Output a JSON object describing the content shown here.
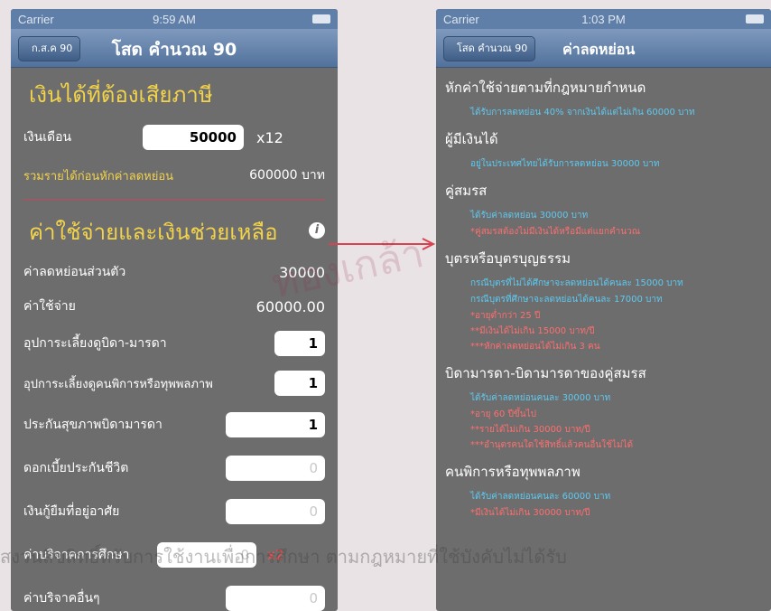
{
  "left": {
    "status": {
      "carrier": "Carrier",
      "time": "9:59 AM"
    },
    "nav": {
      "back": "ก.ส.ค 90",
      "title": "โสด คำนวณ 90"
    },
    "income_header": "เงินได้ที่ต้องเสียภาษี",
    "salary_label": "เงินเดือน",
    "salary_value": "50000",
    "salary_multiplier": "x12",
    "total_label": "รวมรายได้ก่อนหักค่าลดหย่อน",
    "total_value": "600000 บาท",
    "expense_header": "ค่าใช้จ่ายและเงินช่วยเหลือ",
    "rows": [
      {
        "label": "ค่าลดหย่อนส่วนตัว",
        "value": "30000"
      },
      {
        "label": "ค่าใช้จ่าย",
        "value": "60000.00"
      }
    ],
    "fields": [
      {
        "label": "อุปการะเลี้ยงดูบิดา-มารดา",
        "value": "1"
      },
      {
        "label": "อุปการะเลี้ยงดูคนพิการหรือทุพพลภาพ",
        "value": "1"
      },
      {
        "label": "ประกันสุขภาพบิดามารดา",
        "value": "1"
      },
      {
        "label": "ดอกเบี้ยประกันชีวิต",
        "value": "0"
      },
      {
        "label": "เงินกู้ยืมที่อยู่อาศัย",
        "value": "0"
      },
      {
        "label": "ค่าบริจาคการศึกษา",
        "value": "0",
        "suffix": "x2"
      },
      {
        "label": "ค่าบริจาคอื่นๆ",
        "value": "0"
      }
    ]
  },
  "right": {
    "status": {
      "carrier": "Carrier",
      "time": "1:03 PM"
    },
    "nav": {
      "back": "โสด คำนวณ 90",
      "title": "ค่าลดหย่อน"
    },
    "sections": [
      {
        "head": "หักค่าใช้จ่ายตามที่กฎหมายกำหนด",
        "lines": [
          {
            "c": "blue",
            "t": "ได้รับการลดหย่อน 40% จากเงินได้แต่ไม่เกิน 60000 บาท"
          }
        ]
      },
      {
        "head": "ผู้มีเงินได้",
        "lines": [
          {
            "c": "blue",
            "t": "อยู่ในประเทศไทยได้รับการลดหย่อน 30000 บาท"
          }
        ]
      },
      {
        "head": "คู่สมรส",
        "lines": [
          {
            "c": "blue",
            "t": "ได้รับค่าลดหย่อน 30000 บาท"
          },
          {
            "c": "red",
            "t": "*คู่สมรสต้องไม่มีเงินได้หรือมีแต่แยกคำนวณ"
          }
        ]
      },
      {
        "head": "บุตรหรือบุตรบุญธรรม",
        "lines": [
          {
            "c": "blue",
            "t": "กรณีบุตรที่ไม่ได้ศึกษาจะลดหย่อนได้คนละ 15000 บาท"
          },
          {
            "c": "blue",
            "t": "กรณีบุตรที่ศึกษาจะลดหย่อนได้คนละ 17000 บาท"
          },
          {
            "c": "red",
            "t": "*อายุต่ำกว่า 25 ปี"
          },
          {
            "c": "red",
            "t": "**มีเงินได้ไม่เกิน 15000 บาท/ปี"
          },
          {
            "c": "red",
            "t": "***หักค่าลดหย่อนได้ไม่เกิน 3 คน"
          }
        ]
      },
      {
        "head": "บิดามารดา-บิดามารดาของคู่สมรส",
        "lines": [
          {
            "c": "blue",
            "t": "ได้รับค่าลดหย่อนคนละ 30000 บาท"
          },
          {
            "c": "red",
            "t": "*อายุ 60 ปีขึ้นไป"
          },
          {
            "c": "red",
            "t": "**รายได้ไม่เกิน 30000 บาท/ปี"
          },
          {
            "c": "red",
            "t": "***อำนุตรคนใดใช้สิทธิ์แล้วคนอื่นใช้ไม่ได้"
          }
        ]
      },
      {
        "head": "คนพิการหรือทุพพลภาพ",
        "lines": [
          {
            "c": "blue",
            "t": "ได้รับค่าลดหย่อนคนละ 60000 บาท"
          },
          {
            "c": "red",
            "t": "*มีเงินได้ไม่เกิน 30000 บาท/ปี"
          }
        ]
      }
    ]
  },
  "watermark": {
    "bottom": "สงวนลิขสิทธิ์หรับการใช้งานเพื่อการศึกษา ตามกฎหมายที่ใช้บังคับไม่ได้รับ",
    "center": "ทองเกล้า"
  }
}
